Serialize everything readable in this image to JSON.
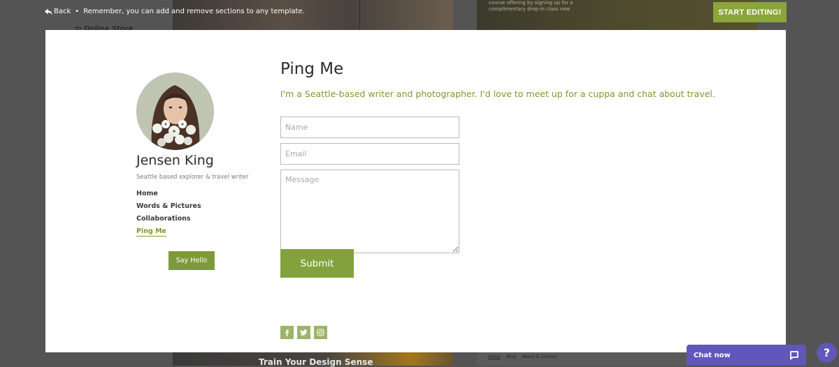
{
  "topbar": {
    "back_label": "Back",
    "separator": "•",
    "notice": "Remember, you can add and remove sections to any template.",
    "online_store_label": "Online Store",
    "start_editing_label": "START EDITING!"
  },
  "background": {
    "right_tile_text": "course offering by signing up for a complimentary drop-in class now",
    "bottom_left_heading": "Train Your Design Sense",
    "bottom_right_nav": [
      "Home",
      "Blog",
      "About & Contact"
    ]
  },
  "profile": {
    "name": "Jensen King",
    "tagline": "Seattle based explorer & travel writer",
    "nav": [
      {
        "label": "Home",
        "active": false
      },
      {
        "label": "Words & Pictures",
        "active": false
      },
      {
        "label": "Collaborations",
        "active": false
      },
      {
        "label": "Ping Me",
        "active": true
      }
    ],
    "say_hello_label": "Say Hello"
  },
  "contact": {
    "heading": "Ping Me",
    "intro": "I'm a Seattle-based writer and photographer. I'd love to meet up for a cuppa and chat about travel.",
    "name_placeholder": "Name",
    "email_placeholder": "Email",
    "message_placeholder": "Message",
    "submit_label": "Submit"
  },
  "social": [
    {
      "icon": "facebook-icon",
      "glyph": "f"
    },
    {
      "icon": "twitter-icon"
    },
    {
      "icon": "instagram-icon"
    }
  ],
  "chat": {
    "label": "Chat now",
    "help_label": "?"
  },
  "colors": {
    "accent_green": "#7c9a2d",
    "start_editing_green": "#8aa53a",
    "chat_purple": "#6157b8",
    "overlay_backdrop": "#545454"
  }
}
